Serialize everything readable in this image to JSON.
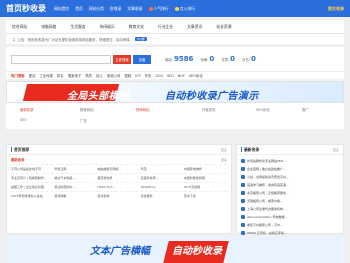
{
  "header": {
    "logo": "首页秒收录",
    "nav": [
      "网站提交",
      "首页",
      "网站分类",
      "秒收录",
      "文章收录"
    ],
    "hot_labels": [
      "人气排行",
      "点入排行"
    ],
    "right_link": "提交收录"
  },
  "categories": [
    "综合网站",
    "电脑网络",
    "生活服务",
    "休闲娱乐",
    "教育文化",
    "行业企业",
    "文章资讯",
    "站长资源"
  ],
  "notice": {
    "text": "公告：首页秒收录为广大站长提供免费收录网站服务，快速提交，自动审核。",
    "badge": "QQ群"
  },
  "search": {
    "placeholder": "",
    "button_primary": "立即搜索",
    "button_secondary": "百度"
  },
  "stats": [
    {
      "label": "网站:",
      "value": "9586"
    },
    {
      "label": "待审:",
      "value": "0"
    },
    {
      "label": "文章:",
      "value": "0"
    },
    {
      "label": "今日:",
      "value": "0"
    }
  ],
  "hot_tags": {
    "label": "热门搜索",
    "items": [
      "爱站",
      "工业传媒",
      "排名",
      "搜索电子",
      "简历",
      "幼儿",
      "家政公司",
      "视频",
      "ICP",
      "外包",
      "GCG",
      "SEO",
      "BUY",
      "SEO优化"
    ]
  },
  "banner": {
    "text_left": "全局头部横幅",
    "text_right": "自动秒收录广告演示"
  },
  "tabs": [
    "最新收录",
    "推荐网站",
    "快审网站",
    "外链发布",
    "SEO优化",
    "推广",
    "SEO",
    "广告"
  ],
  "left_panel": {
    "title": "首页推荐",
    "more": "更多",
    "subhead": "最新收录",
    "sub_more": "更多",
    "rows": [
      [
        "不同公司是如此地不同",
        "华夏云网...",
        "电脑故障与网络...",
        "风雷",
        "中国家电维修"
      ],
      [
        "专业宣传片 | 短视频制作...",
        "湖北汽车购票...",
        "首页秒收录",
        "百度秒收录...",
        "中国智能建筑网"
      ],
      [
        "提醒工作 | 企业信息管理",
        "营业执照快办...",
        "HX2A Fort...",
        "NetsMono",
        "Wi-Fi无线网"
      ],
      [
        "2023年秒收录新入驻站",
        "游戏攻略",
        "英文秒收",
        "综合服务",
        "安卓下载"
      ]
    ]
  },
  "right_panel": {
    "title": "最新收录",
    "more": "更多",
    "items": [
      "外贸站群优化专业网站SEO...",
      "企业官网 | 独立站建站推广...",
      "小站 - 全网最新资讯聚合平台...",
      "英语学习推荐 - 青春有道英语...",
      "北京搬家公司 - 正规搬家服务...",
      "无锡搬家公司 - 搬家价格...",
      "上海公司注册代办服务机构...",
      "Abnormal Data | 异常数据...",
      "重庆万州搬家公司 - 万州...",
      "VMOS 云手机 - 虚拟云手机..."
    ]
  },
  "bottom_banner": {
    "text_left": "文本广告横幅",
    "text_right": "自动秒收录"
  },
  "colors": {
    "primary": "#2a6fdb",
    "accent": "#e33c2c",
    "background": "#f0f0f0"
  }
}
